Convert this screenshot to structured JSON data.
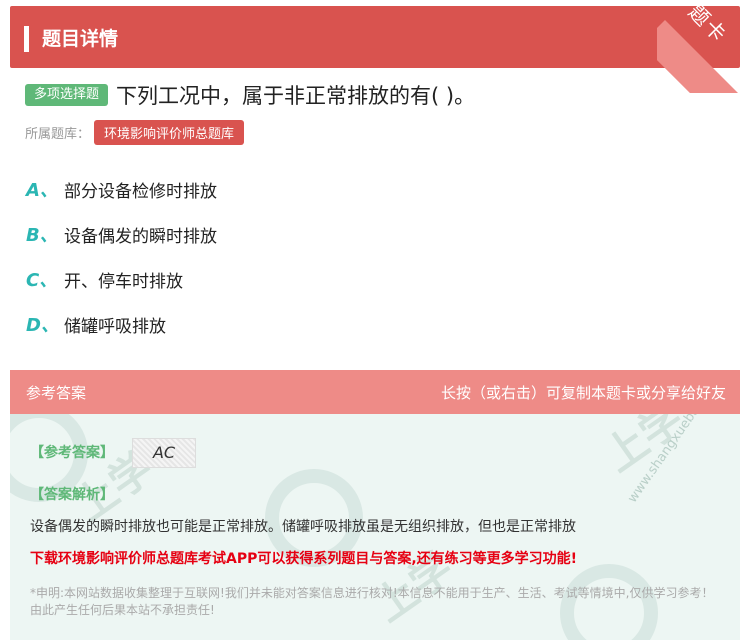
{
  "header": {
    "title": "题目详情",
    "ribbon": "题卡"
  },
  "question": {
    "type_badge": "多项选择题",
    "text": "下列工况中，属于非正常排放的有( )。",
    "bank_label": "所属题库：",
    "bank_name": "环境影响评价师总题库"
  },
  "options": [
    {
      "letter": "A、",
      "text": "部分设备检修时排放"
    },
    {
      "letter": "B、",
      "text": "设备偶发的瞬时排放"
    },
    {
      "letter": "C、",
      "text": "开、停车时排放"
    },
    {
      "letter": "D、",
      "text": "储罐呼吸排放"
    }
  ],
  "answer": {
    "header_left": "参考答案",
    "header_right": "长按（或右击）可复制本题卡或分享给好友",
    "answer_label": "【参考答案】",
    "answer_value": "AC",
    "explain_label": "【答案解析】",
    "explain_text": "设备偶发的瞬时排放也可能是正常排放。储罐呼吸排放虽是无组织排放，但也是正常排放",
    "promo": "下载环境影响评价师总题库考试APP可以获得系列题目与答案,还有练习等更多学习功能!",
    "notice": "*申明:本网站数据收集整理于互联网!我们并未能对答案信息进行核对!本信息不能用于生产、生活、考试等情境中,仅供学习参考！由此产生任何后果本站不承担责任!"
  },
  "colors": {
    "accent_red": "#d9534f",
    "accent_green": "#5fb878",
    "option_letter": "#2bb6b3"
  }
}
